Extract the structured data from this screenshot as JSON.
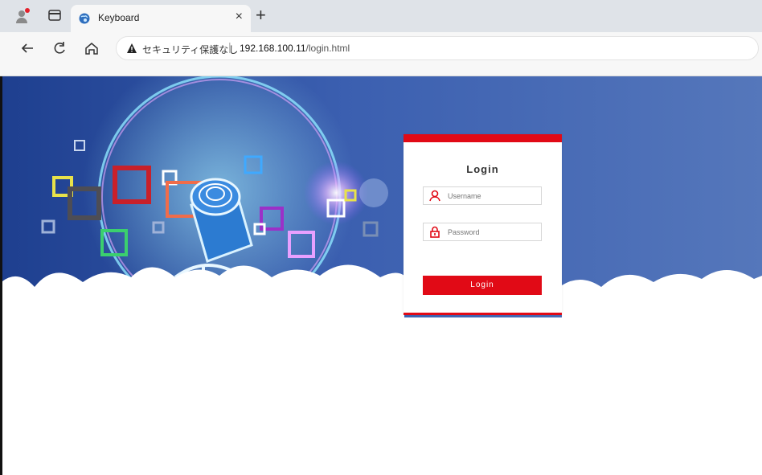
{
  "browser": {
    "tab": {
      "title": "Keyboard",
      "close": "×"
    },
    "new_tab": "+",
    "address_bar": {
      "security_text": "セキュリティ保護なし",
      "separator": "|",
      "url_host": "192.168.100.11",
      "url_path": "/login.html"
    },
    "icons": [
      "profile-icon",
      "tab-actions-icon",
      "back-icon",
      "reload-icon",
      "home-icon",
      "warning-icon",
      "globe-favicon-icon"
    ]
  },
  "login": {
    "title": "Login",
    "username_placeholder": "Username",
    "password_placeholder": "Password",
    "button_label": "Login"
  },
  "colors": {
    "accent": "#e10a16",
    "banner": "#4b6fb8"
  }
}
